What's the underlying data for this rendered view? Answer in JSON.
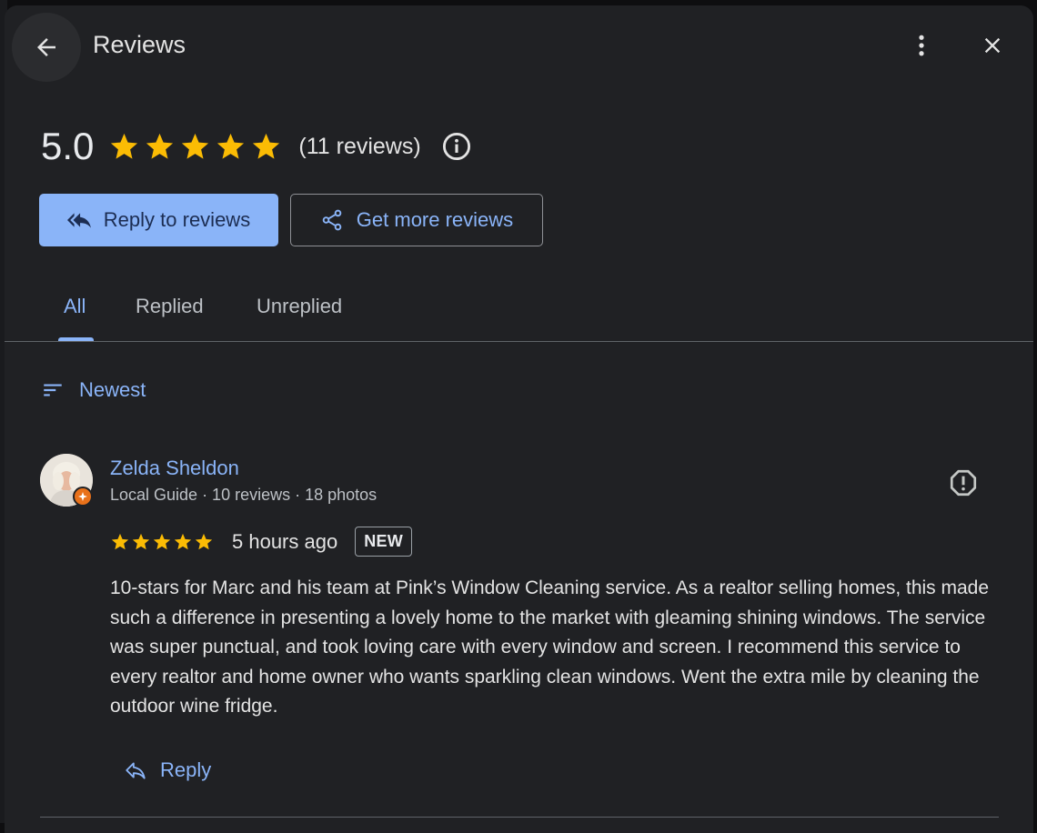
{
  "colors": {
    "panel_bg": "#202124",
    "accent_blue": "#8ab4f8",
    "star_yellow": "#fbbc04",
    "local_guide_orange": "#e8711a"
  },
  "header": {
    "title": "Reviews",
    "back_icon": "arrow-left-icon",
    "more_icon": "more-vert-icon",
    "close_icon": "close-icon"
  },
  "summary": {
    "rating_value": "5.0",
    "rating_stars": 5,
    "review_count": "(11 reviews)",
    "info_icon": "info-icon"
  },
  "actions": {
    "reply_to_reviews": "Reply to reviews",
    "get_more_reviews": "Get more reviews"
  },
  "tabs": [
    {
      "label": "All",
      "active": true
    },
    {
      "label": "Replied",
      "active": false
    },
    {
      "label": "Unreplied",
      "active": false
    }
  ],
  "sort": {
    "label": "Newest",
    "icon": "sort-icon"
  },
  "reviews": [
    {
      "name": "Zelda Sheldon",
      "meta": "Local Guide · 10 reviews · 18 photos",
      "stars": 5,
      "time": "5 hours ago",
      "badge": "NEW",
      "text": "10-stars for Marc and his team at Pink’s Window Cleaning service. As a realtor selling homes, this made such a difference in presenting a lovely home to the market with gleaming shining windows. The service was super punctual, and took loving care with every window and screen. I recommend this service to every realtor and home owner who wants sparkling clean windows. Went the extra mile by cleaning the outdoor wine fridge.",
      "reply_label": "Reply"
    }
  ]
}
